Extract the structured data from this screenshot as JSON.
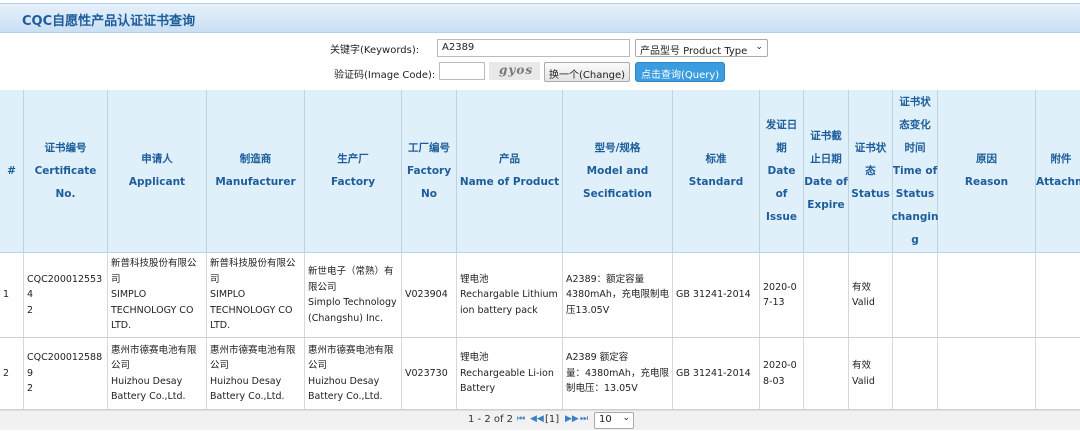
{
  "page_title": "CQC自愿性产品认证证书查询",
  "search": {
    "keyword_label": "关键字(Keywords):",
    "keyword_value": "A2389",
    "product_type_selected": "产品型号 Product Type",
    "image_code_label": "验证码(Image Code):",
    "image_code_value": "",
    "captcha_text": "gyos",
    "change_button": "换一个(Change)",
    "query_button": "点击查询(Query)"
  },
  "table": {
    "headers": [
      {
        "cn": "#",
        "en": ""
      },
      {
        "cn": "证书编号",
        "en": "Certificate No."
      },
      {
        "cn": "申请人",
        "en": "Applicant"
      },
      {
        "cn": "制造商",
        "en": "Manufacturer"
      },
      {
        "cn": "生产厂",
        "en": "Factory"
      },
      {
        "cn": "工厂编号",
        "en": "Factory\nNo"
      },
      {
        "cn": "产品",
        "en": "Name of Product"
      },
      {
        "cn": "型号/规格",
        "en": "Model and\nSecification"
      },
      {
        "cn": "标准",
        "en": "Standard"
      },
      {
        "cn": "发证日\n期",
        "en": "Date of\nIssue"
      },
      {
        "cn": "证书截\n止日期",
        "en": "Date of\nExpire"
      },
      {
        "cn": "证书状\n态",
        "en": "Status"
      },
      {
        "cn": "证书状\n态变化\n时间",
        "en": "Time of\nStatus\nchangin\ng"
      },
      {
        "cn": "原因",
        "en": "Reason"
      },
      {
        "cn": "附件",
        "en": "Attachm"
      }
    ],
    "rows": [
      {
        "num": "1",
        "certificate_no": "CQC2000125534\n2",
        "applicant": "新普科技股份有限公\n司\nSIMPLO\nTECHNOLOGY CO\nLTD.",
        "manufacturer": "新普科技股份有限公\n司\nSIMPLO\nTECHNOLOGY CO\nLTD.",
        "factory": "新世电子（常熟）有\n限公司\nSimplo Technology\n(Changshu) Inc.",
        "factory_no": "V023904",
        "product": "锂电池\nRechargable Lithium\nion battery pack",
        "model": "A2389：额定容量\n4380mAh，充电限制电\n压13.05V",
        "standard": "GB 31241-2014",
        "issue_date": "2020-0\n7-13",
        "expire_date": "",
        "status": "有效\nValid",
        "status_time": "",
        "reason": "",
        "attachment": ""
      },
      {
        "num": "2",
        "certificate_no": "CQC2000125889\n2",
        "applicant": "惠州市德赛电池有限\n公司\nHuizhou Desay\nBattery Co.,Ltd.",
        "manufacturer": "惠州市德赛电池有限\n公司\nHuizhou Desay\nBattery Co.,Ltd.",
        "factory": "惠州市德赛电池有限\n公司\nHuizhou Desay\nBattery Co.,Ltd.",
        "factory_no": "V023730",
        "product": "锂电池\nRechargeable Li-ion\nBattery",
        "model": "A2389 额定容\n量：4380mAh，充电限\n制电压：13.05V",
        "standard": "GB 31241-2014",
        "issue_date": "2020-0\n8-03",
        "expire_date": "",
        "status": "有效\nValid",
        "status_time": "",
        "reason": "",
        "attachment": ""
      }
    ]
  },
  "pager": {
    "range_text": "1 - 2 of 2",
    "first": "⏮",
    "prev": "◀◀",
    "current": "[1]",
    "next": "▶▶",
    "last": "⏭",
    "page_size": "10"
  }
}
